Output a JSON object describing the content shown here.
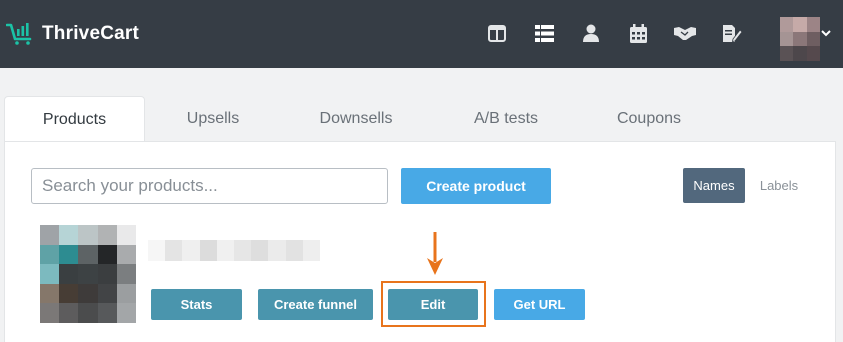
{
  "app": {
    "name": "ThriveCart",
    "brand_color": "#1bc3a6",
    "topbar_color": "#363d45"
  },
  "nav": {
    "icons": [
      "dashboard-icon",
      "list-icon",
      "user-icon",
      "calendar-icon",
      "handshake-icon",
      "edit-document-icon"
    ]
  },
  "tabs": [
    {
      "label": "Products",
      "active": true
    },
    {
      "label": "Upsells"
    },
    {
      "label": "Downsells"
    },
    {
      "label": "A/B tests"
    },
    {
      "label": "Coupons"
    }
  ],
  "search": {
    "placeholder": "Search your products..."
  },
  "toolbar": {
    "create_label": "Create product",
    "names_label": "Names",
    "labels_label": "Labels"
  },
  "product": {
    "actions": {
      "stats": "Stats",
      "create_funnel": "Create funnel",
      "edit": "Edit",
      "get_url": "Get URL"
    }
  },
  "colors": {
    "accent_blue": "#48a9e6",
    "teal_button": "#4a95ad",
    "highlight": "#e8741c",
    "toggle_active": "#52687d"
  }
}
